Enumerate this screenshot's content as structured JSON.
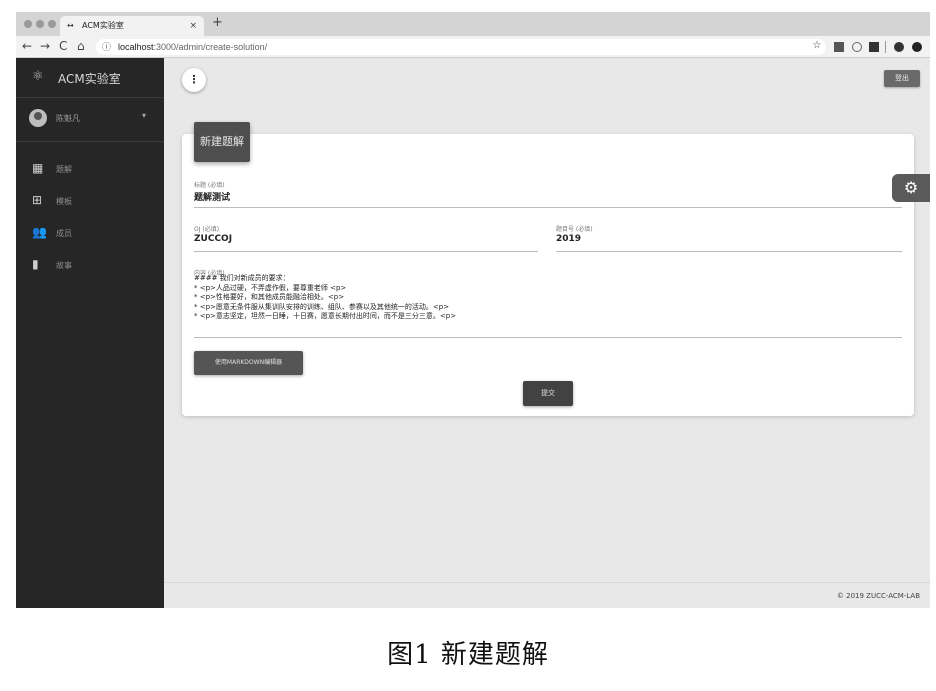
{
  "browser": {
    "tab_title": "ACM实验室",
    "tab_icon": "react-icon",
    "tab_close": "×",
    "new_tab": "+",
    "address_host": "localhost",
    "address_path": ":3000/admin/create-solution/",
    "back": "←",
    "forward": "→",
    "reload": "C",
    "home": "⌂",
    "info": "ⓘ",
    "star": "☆"
  },
  "sidebar": {
    "brand": "ACM实验室",
    "brand_icon": "⚛",
    "user_name": "陈魁凡",
    "caret": "▾",
    "items": [
      {
        "label": "题解",
        "icon": "▦"
      },
      {
        "label": "模板",
        "icon": "⊞"
      },
      {
        "label": "成员",
        "icon": "👥"
      },
      {
        "label": "故事",
        "icon": "▮"
      }
    ]
  },
  "header": {
    "more_icon": "⋮",
    "logout_label": "登出"
  },
  "form": {
    "card_title": "新建题解",
    "title_label": "标题 (必填)",
    "title_value": "题解测试",
    "oj_label": "OJ (必填)",
    "oj_value": "ZUCCOJ",
    "problem_label": "题目号 (必填)",
    "problem_value": "2019",
    "content_label": "内容 (必填)",
    "content_lines": [
      "#### 我们对新成员的要求：",
      "",
      "* <p>人品过硬，不弄虚作假，要尊重老师 <p>",
      "* <p>性格要好，和其他成员能融洽相处。<p>",
      "* <p>愿意无条件服从集训队安排的训练、组队、参赛以及其他统一的活动。<p>",
      "* <p>意志坚定，坦然一日睡，十日赛，愿意长期付出时间，而不是三分三意。<p>"
    ],
    "markdown_button": "使用MARKDOWN编辑器",
    "submit_button": "提交"
  },
  "settings_icon": "⚙",
  "footer": {
    "copyright": "© 2019 ZUCC-ACM-LAB"
  },
  "caption": "图1   新建题解"
}
